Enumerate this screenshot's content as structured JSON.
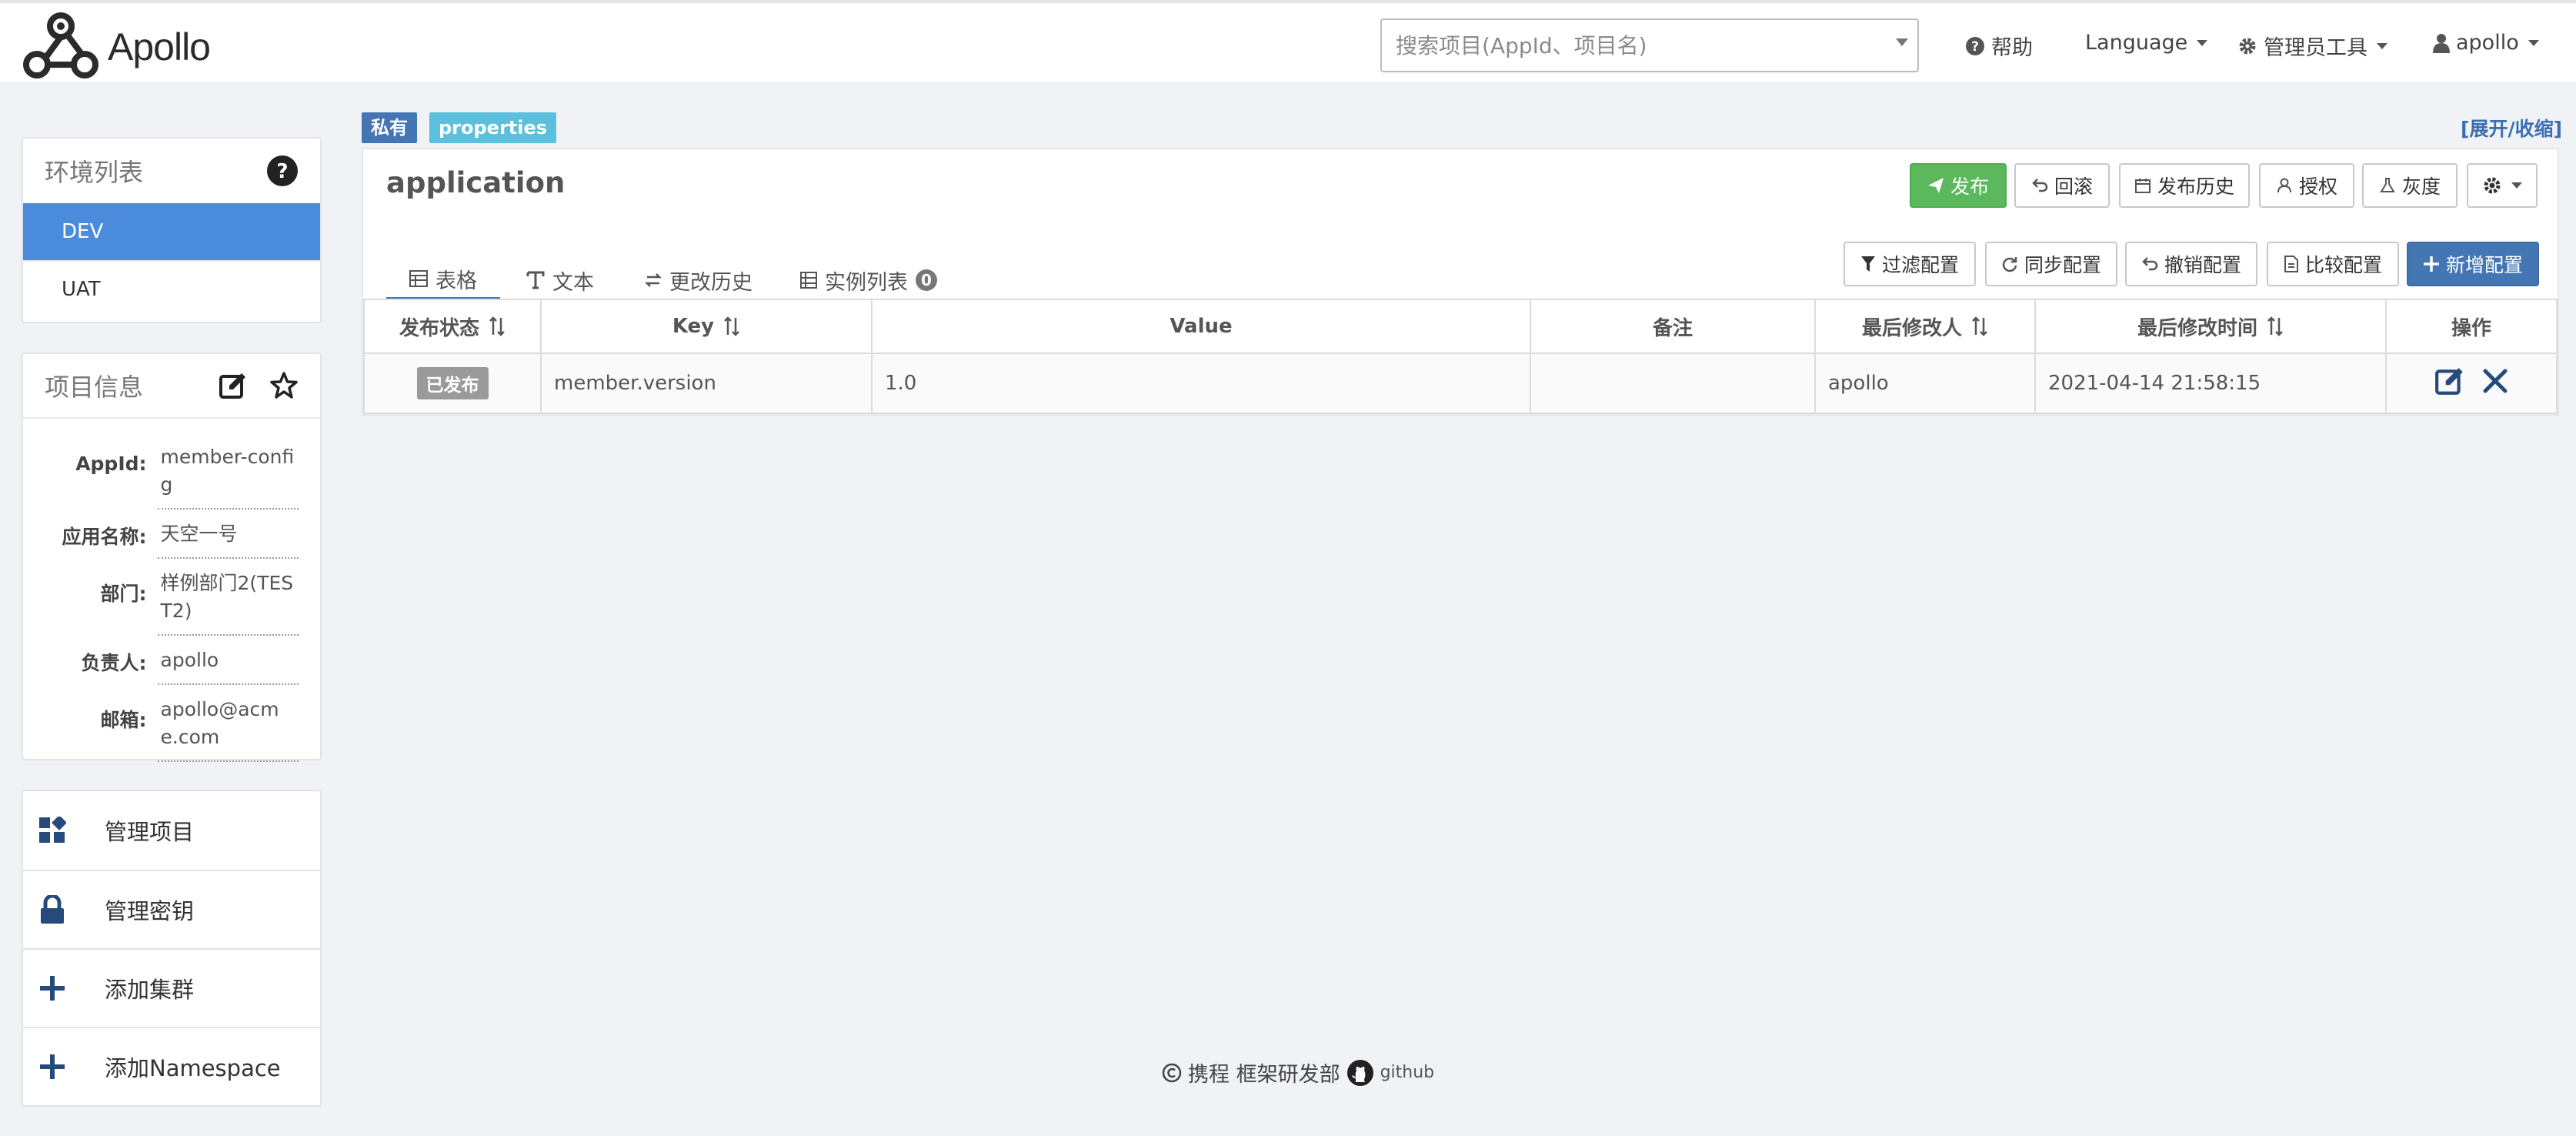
{
  "header": {
    "logo_text": "Apollo",
    "search_placeholder": "搜索项目(AppId、项目名)",
    "help": "帮助",
    "language": "Language",
    "admin_tools": "管理员工具",
    "user": "apollo"
  },
  "env_panel": {
    "title": "环境列表",
    "items": [
      {
        "label": "DEV",
        "active": true
      },
      {
        "label": "UAT",
        "active": false
      }
    ]
  },
  "project_info": {
    "title": "项目信息",
    "rows": [
      {
        "label": "AppId:",
        "value": "member-config"
      },
      {
        "label": "应用名称:",
        "value": "天空一号"
      },
      {
        "label": "部门:",
        "value": "样例部门2(TEST2)"
      },
      {
        "label": "负责人:",
        "value": "apollo"
      },
      {
        "label": "邮箱:",
        "value": "apollo@acme.com"
      }
    ]
  },
  "side_menu": [
    {
      "label": "管理项目",
      "icon": "dashboard-icon"
    },
    {
      "label": "管理密钥",
      "icon": "lock-icon"
    },
    {
      "label": "添加集群",
      "icon": "plus-icon"
    },
    {
      "label": "添加Namespace",
      "icon": "plus-icon"
    }
  ],
  "namespace": {
    "tag_private": "私有",
    "tag_format": "properties",
    "expand_toggle": "[展开/收缩]",
    "name": "application",
    "actions": {
      "publish": "发布",
      "rollback": "回滚",
      "history": "发布历史",
      "authorize": "授权",
      "gray": "灰度"
    },
    "tabs": {
      "table": "表格",
      "text": "文本",
      "change_history": "更改历史",
      "instances": "实例列表",
      "instances_count": "0"
    },
    "tools": {
      "filter": "过滤配置",
      "sync": "同步配置",
      "revoke": "撤销配置",
      "compare": "比较配置",
      "add": "新增配置"
    },
    "table": {
      "columns": [
        "发布状态",
        "Key",
        "Value",
        "备注",
        "最后修改人",
        "最后修改时间",
        "操作"
      ],
      "rows": [
        {
          "status": "已发布",
          "key": "member.version",
          "value": "1.0",
          "comment": "",
          "modifier": "apollo",
          "modified_time": "2021-04-14 21:58:15"
        }
      ]
    }
  },
  "footer": {
    "text": "携程 框架研发部",
    "github": "github"
  },
  "colors": {
    "primary": "#4a8cdb",
    "success": "#5cb85c",
    "tag_private": "#4476b4",
    "tag_format": "#5bc0de"
  }
}
